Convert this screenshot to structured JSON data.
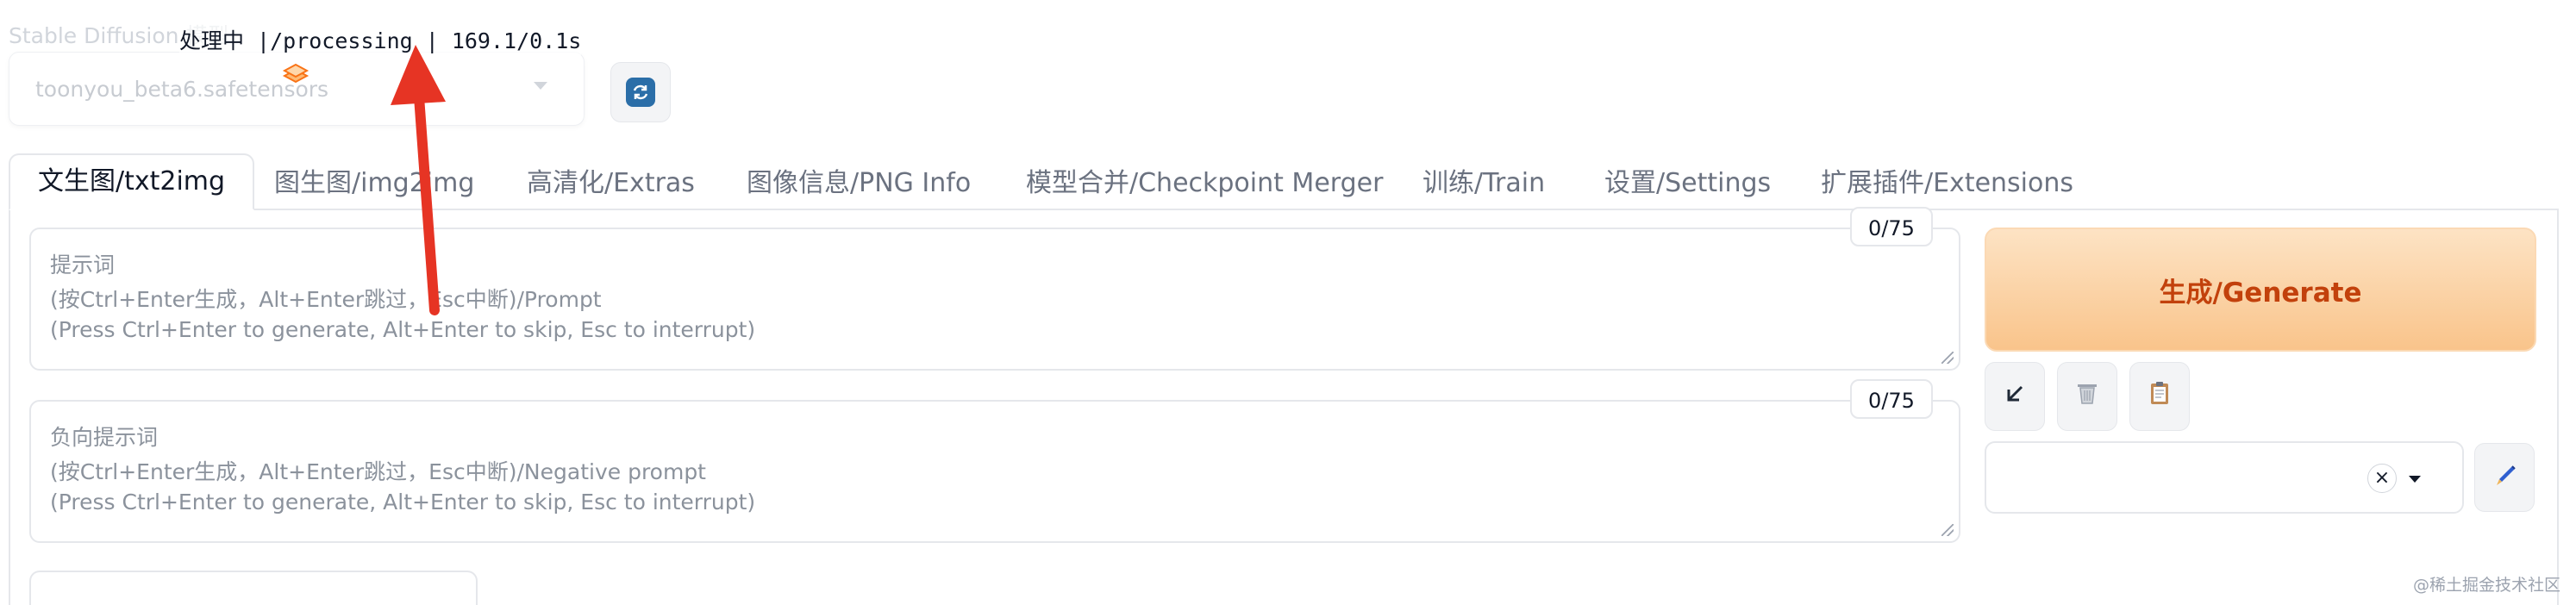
{
  "header": {
    "checkpoint_label": "Stable Diffusion 模型",
    "checkpoint_value": "toonyou_beta6.safetensors",
    "status_tooltip": "处理中 |/processing | 169.1/0.1s",
    "refresh_icon": "refresh-icon",
    "library_icon": "stack-icon"
  },
  "tabs": [
    {
      "label": "文生图/txt2img",
      "active": true
    },
    {
      "label": "图生图/img2img"
    },
    {
      "label": "高清化/Extras"
    },
    {
      "label": "图像信息/PNG Info"
    },
    {
      "label": "模型合并/Checkpoint Merger"
    },
    {
      "label": "训练/Train"
    },
    {
      "label": "设置/Settings"
    },
    {
      "label": "扩展插件/Extensions"
    }
  ],
  "prompt": {
    "counter": "0/75",
    "line1": "提示词",
    "line2": "(按Ctrl+Enter生成，Alt+Enter跳过，Esc中断)/Prompt",
    "line3": "(Press Ctrl+Enter to generate, Alt+Enter to skip, Esc to interrupt)"
  },
  "negative_prompt": {
    "counter": "0/75",
    "line1": "负向提示词",
    "line2": "(按Ctrl+Enter生成，Alt+Enter跳过，Esc中断)/Negative prompt",
    "line3": "(Press Ctrl+Enter to generate, Alt+Enter to skip, Esc to interrupt)"
  },
  "generate": {
    "label": "生成/Generate"
  },
  "tools": {
    "apply_icon": "arrow-down-left-icon",
    "trash_icon": "trash-icon",
    "paste_icon": "clipboard-icon",
    "edit_icon": "pencil-icon",
    "clear_symbol": "×"
  },
  "watermark": "@稀土掘金技术社区",
  "colors": {
    "accent": "#f97316",
    "generate_bg": "#fcd3a3",
    "generate_text": "#c2410c",
    "arrow": "#e63424"
  }
}
